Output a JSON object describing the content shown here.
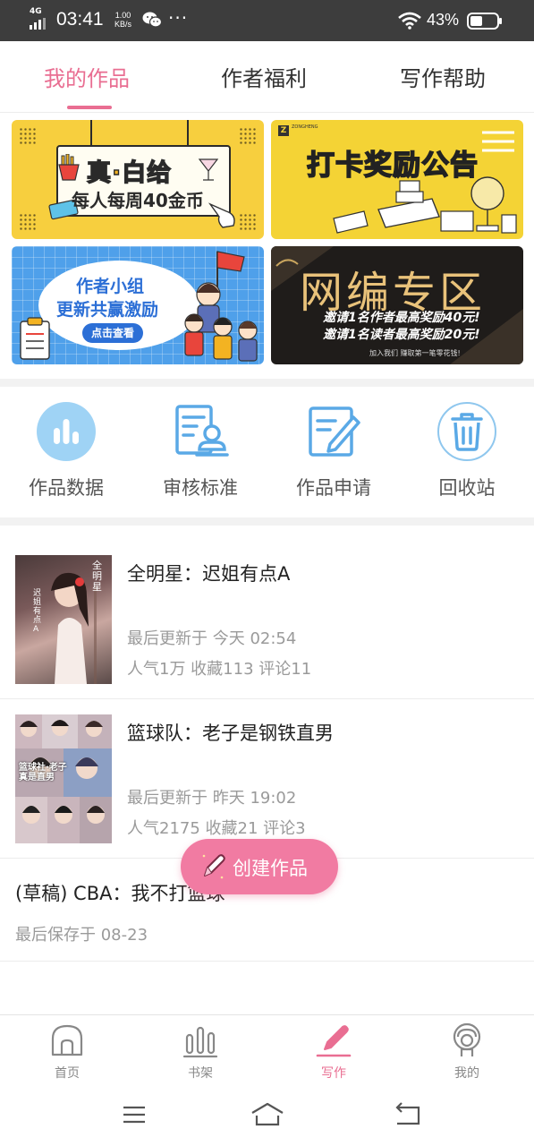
{
  "status_bar": {
    "network": "4G",
    "time": "03:41",
    "speed_value": "1.00",
    "speed_unit": "KB/s",
    "more": "···",
    "battery": "43%",
    "icons": [
      "signal-icon",
      "wechat-icon",
      "wifi-icon",
      "battery-icon"
    ]
  },
  "tabs": [
    {
      "label": "我的作品",
      "active": true
    },
    {
      "label": "作者福利",
      "active": false
    },
    {
      "label": "写作帮助",
      "active": false
    }
  ],
  "banners": {
    "b1": {
      "title": "真·白给",
      "subtitle": "每人每周40金币"
    },
    "b2": {
      "title": "打卡奖励公告",
      "brand": "ZONGHENG"
    },
    "b3": {
      "line1": "作者小组",
      "line2": "更新共赢激励",
      "button": "点击查看"
    },
    "b4": {
      "title": "网编专区",
      "line1": "邀请1名作者最高奖励40元!",
      "line2": "邀请1名读者最高奖励20元!",
      "footer": "加入我们  赚取第一笔零花钱!"
    }
  },
  "quick_menu": [
    {
      "label": "作品数据",
      "icon": "bar-chart-icon"
    },
    {
      "label": "审核标准",
      "icon": "review-document-icon"
    },
    {
      "label": "作品申请",
      "icon": "edit-form-icon"
    },
    {
      "label": "回收站",
      "icon": "trash-icon"
    }
  ],
  "works": [
    {
      "title": "全明星：迟姐有点A",
      "updated": "最后更新于 今天 02:54",
      "stats": "人气1万 收藏113 评论11",
      "cover_text": "全明星",
      "cover_subtext": "迟姐有点A"
    },
    {
      "title": "篮球队：老子是钢铁直男",
      "updated": "最后更新于 昨天 19:02",
      "stats": "人气2175 收藏21 评论3",
      "cover_text": "篮球社·老子真是直男"
    }
  ],
  "draft": {
    "title": "(草稿) CBA：我不打篮球",
    "saved": "最后保存于 08-23"
  },
  "fab": {
    "label": "创建作品"
  },
  "bottom_nav": [
    {
      "label": "首页",
      "icon": "home-icon",
      "active": false
    },
    {
      "label": "书架",
      "icon": "bookshelf-icon",
      "active": false
    },
    {
      "label": "写作",
      "icon": "pen-icon",
      "active": true
    },
    {
      "label": "我的",
      "icon": "profile-icon",
      "active": false
    }
  ],
  "colors": {
    "accent": "#e96e92",
    "fab": "#f17ba2",
    "icon_blue": "#5aa9e6"
  }
}
